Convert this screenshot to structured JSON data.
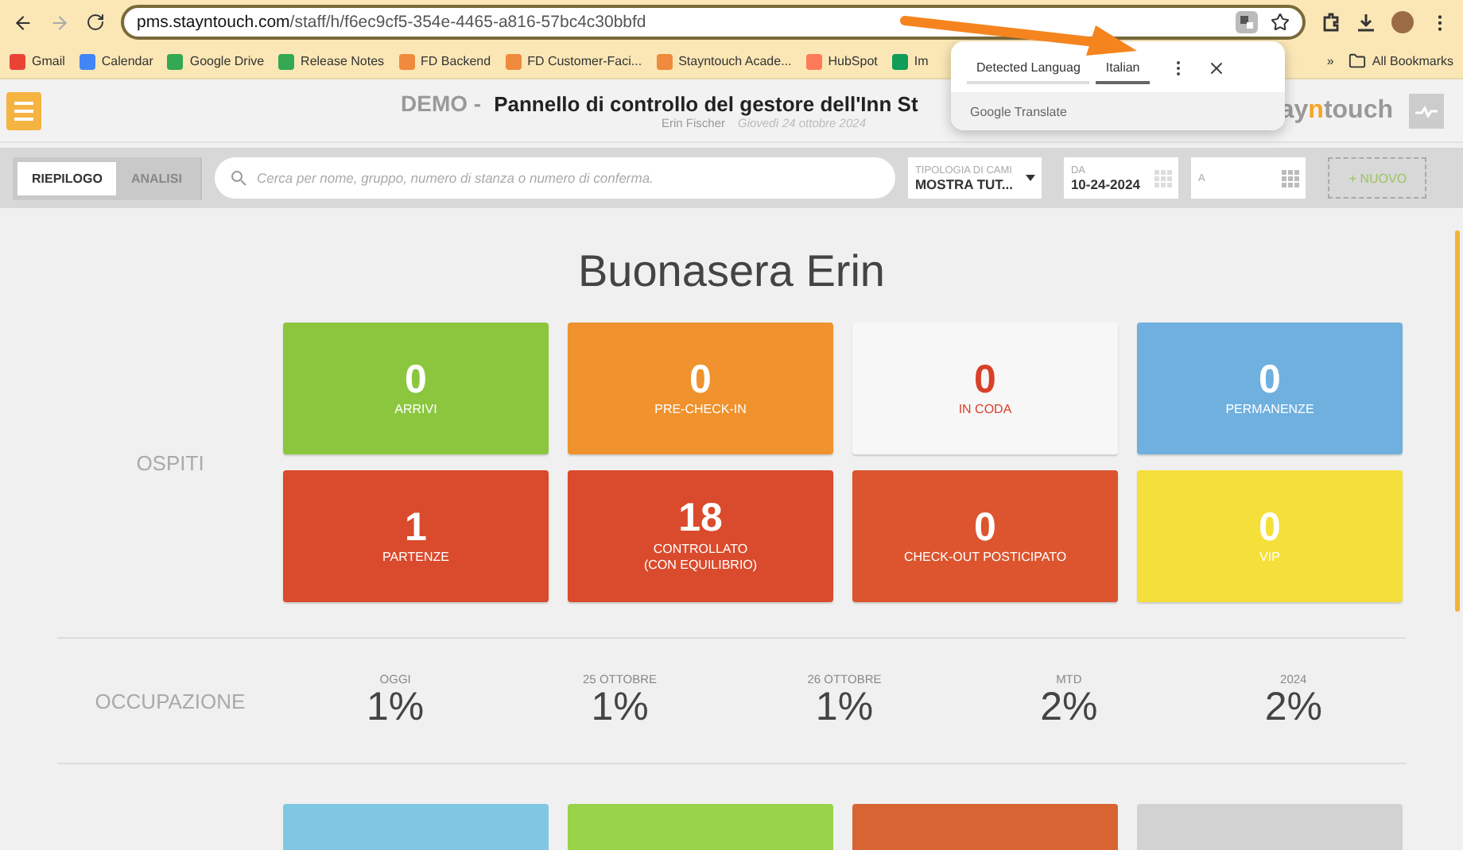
{
  "browser": {
    "url_host": "pms.stayntouch.com",
    "url_path": "/staff/h/f6ec9cf5-354e-4465-a816-57bc4c30bbfd",
    "bookmarks": [
      {
        "label": "Gmail",
        "kind": "gmail"
      },
      {
        "label": "Calendar",
        "kind": "calendar"
      },
      {
        "label": "Google Drive",
        "kind": "drive"
      },
      {
        "label": "Release Notes",
        "kind": "drive"
      },
      {
        "label": "FD Backend",
        "kind": "snt"
      },
      {
        "label": "FD Customer-Faci...",
        "kind": "snt"
      },
      {
        "label": "Stayntouch Acade...",
        "kind": "snt"
      },
      {
        "label": "HubSpot",
        "kind": "hubspot"
      },
      {
        "label": "Im",
        "kind": "sheet"
      }
    ],
    "more": "»",
    "all_bookmarks": "All Bookmarks"
  },
  "translate_popup": {
    "tabs": [
      {
        "label": "Detected Languag",
        "selected": false
      },
      {
        "label": "Italian",
        "selected": true
      }
    ],
    "footer_brand": "Google",
    "footer_product": "Translate"
  },
  "header": {
    "demo": "DEMO -",
    "title": "Pannello di controllo del gestore dell'Inn St",
    "user": "Erin Fischer",
    "date": "Giovedì 24 ottobre 2024",
    "logo": {
      "before": "ay",
      "accent": "n",
      "after": "touch"
    }
  },
  "toolbar": {
    "tabs": [
      {
        "label": "RIEPILOGO",
        "selected": true
      },
      {
        "label": "ANALISI",
        "selected": false
      }
    ],
    "search": {
      "placeholder": "Cerca per nome, gruppo, numero di stanza o numero di conferma."
    },
    "room_type": {
      "label": "TIPOLOGIA DI CAMI",
      "value": "MOSTRA TUT..."
    },
    "from": {
      "label": "DA",
      "value": "10-24-2024"
    },
    "to": {
      "label": "A"
    },
    "new_button": "+ NUOVO"
  },
  "greeting": "Buonasera Erin",
  "guests": {
    "label": "OSPITI",
    "tiles": [
      {
        "count": "0",
        "label": "ARRIVI",
        "color": "#8cc63f",
        "kind": "solid"
      },
      {
        "count": "0",
        "label": "PRE-CHECK-IN",
        "color": "#f0922d",
        "kind": "solid"
      },
      {
        "count": "0",
        "label": "IN CODA",
        "color": "#f7f7f7",
        "kind": "light"
      },
      {
        "count": "0",
        "label": "PERMANENZE",
        "color": "#6fb0df",
        "kind": "solid"
      },
      {
        "count": "1",
        "label": "PARTENZE",
        "color": "#da4a2c",
        "kind": "solid"
      },
      {
        "count": "18",
        "label": "CONTROLLATO",
        "sublabel": "(CON EQUILIBRIO)",
        "color": "#da4a2c",
        "kind": "solid"
      },
      {
        "count": "0",
        "label": "CHECK-OUT POSTICIPATO",
        "color": "#dc552e",
        "kind": "solid"
      },
      {
        "count": "0",
        "label": "VIP",
        "color": "#f5df3a",
        "kind": "solid"
      }
    ]
  },
  "occupancy": {
    "label": "OCCUPAZIONE",
    "items": [
      {
        "period": "OGGI",
        "value": "1%"
      },
      {
        "period": "25 OTTOBRE",
        "value": "1%"
      },
      {
        "period": "26 OTTOBRE",
        "value": "1%"
      },
      {
        "period": "MTD",
        "value": "2%"
      },
      {
        "period": "2024",
        "value": "2%"
      }
    ]
  },
  "bottom_tiles": [
    {
      "color": "#80c8e2"
    },
    {
      "color": "#99d34a"
    },
    {
      "color": "#d86434"
    },
    {
      "color": "#d2d2d2"
    }
  ]
}
